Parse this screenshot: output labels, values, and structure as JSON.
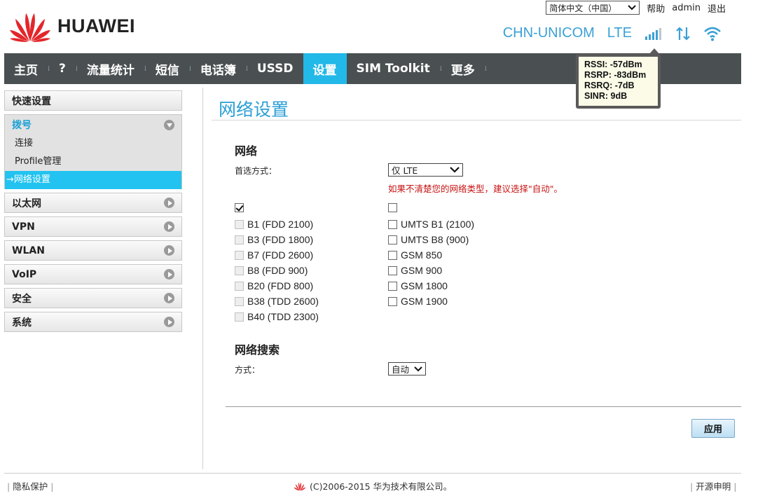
{
  "header": {
    "brand": "HUAWEI",
    "language": "简体中文（中国）",
    "help": "帮助",
    "user": "admin",
    "logout": "退出",
    "carrier": "CHN-UNICOM",
    "network_type": "LTE"
  },
  "signal_tooltip": {
    "rssi": "RSSI: -57dBm",
    "rsrp": "RSRP: -83dBm",
    "rsrq": "RSRQ: -7dB",
    "sinr": "SINR: 9dB"
  },
  "nav": {
    "items": [
      "主页",
      "?",
      "流量统计",
      "短信",
      "电话簿",
      "USSD",
      "设置",
      "SIM Toolkit",
      "更多"
    ],
    "active": "设置"
  },
  "sidebar": {
    "quick_setup": "快速设置",
    "dialup": "拨号",
    "dialup_items": [
      "连接",
      "Profile管理",
      "→网络设置"
    ],
    "groups": [
      "以太网",
      "VPN",
      "WLAN",
      "VoIP",
      "安全",
      "系统"
    ]
  },
  "main": {
    "title": "网络设置",
    "network_section": "网络",
    "preferred_label": "首选方式：",
    "preferred_value": "仅 LTE",
    "hint": "如果不清楚您的网络类型，建议选择\"自动\"。",
    "lte_bands": [
      "B1 (FDD 2100)",
      "B3 (FDD 1800)",
      "B7 (FDD 2600)",
      "B8 (FDD 900)",
      "B20 (FDD 800)",
      "B38 (TDD 2600)",
      "B40 (TDD 2300)"
    ],
    "other_bands": [
      "UMTS B1 (2100)",
      "UMTS B8 (900)",
      "GSM 850",
      "GSM 900",
      "GSM 1800",
      "GSM 1900"
    ],
    "search_section": "网络搜索",
    "mode_label": "方式：",
    "mode_value": "自动",
    "apply": "应用"
  },
  "footer": {
    "privacy": "隐私保护",
    "copyright": "(C)2006-2015 华为技术有限公司。",
    "opensource": "开源申明"
  },
  "colors": {
    "accent": "#22b8e8",
    "nav_bg": "#4a4f52",
    "title": "#2a9fd6",
    "hint": "#c81414",
    "brand_red": "#e3262b"
  }
}
